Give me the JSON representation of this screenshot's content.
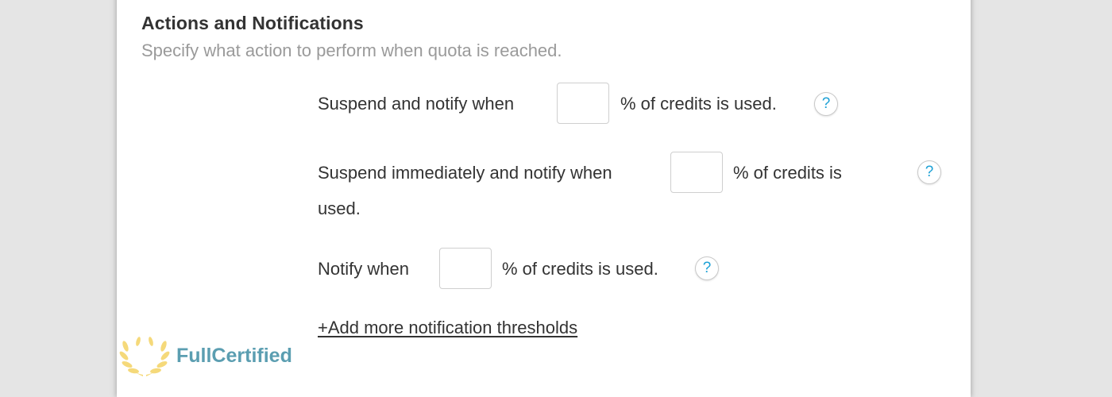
{
  "section": {
    "title": "Actions and Notifications",
    "subtitle": "Specify what action to perform when quota is reached."
  },
  "rules": [
    {
      "prefix": "Suspend and notify when",
      "suffix": "% of credits is used.",
      "value": "",
      "help": "?"
    },
    {
      "prefix": "Suspend immediately and notify when",
      "suffix": "% of credits is",
      "suffix_wrap": "used.",
      "value": "",
      "help": "?"
    },
    {
      "prefix": "Notify when",
      "suffix": "% of credits is used.",
      "value": "",
      "help": "?"
    }
  ],
  "add_link": "+Add more notification thresholds",
  "watermark": {
    "text": "FullCertified",
    "icon": "laurel-wreath-icon"
  },
  "colors": {
    "background": "#e5e5e5",
    "panel": "#ffffff",
    "text": "#333333",
    "subtitle": "#9a9a9a",
    "help_accent": "#1da1d6",
    "watermark_text": "#5b9eb1",
    "watermark_icon": "#f5d97a"
  }
}
